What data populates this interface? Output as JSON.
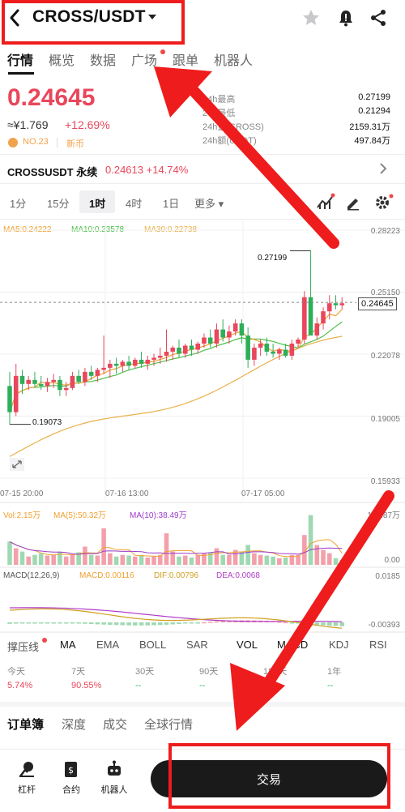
{
  "header": {
    "pair": "CROSS/USDT",
    "icons": [
      "back-icon",
      "chevron-down-icon",
      "star-icon",
      "alert-bell-icon",
      "share-icon"
    ]
  },
  "tabs": [
    {
      "label": "行情",
      "active": true
    },
    {
      "label": "概览"
    },
    {
      "label": "数据"
    },
    {
      "label": "广场",
      "dot": true
    },
    {
      "label": "跟单"
    },
    {
      "label": "机器人"
    }
  ],
  "quote": {
    "price": "0.24645",
    "cny": "≈¥1.769",
    "change_pct": "+12.69%",
    "rank": "NO.23",
    "tag": "新币"
  },
  "stats": [
    {
      "label": "24h最高",
      "value": "0.27199"
    },
    {
      "label": "24h最低",
      "value": "0.21294"
    },
    {
      "label": "24h量(CROSS)",
      "value": "2159.31万"
    },
    {
      "label": "24h额(USDT)",
      "value": "497.84万"
    }
  ],
  "perpetual": {
    "label": "CROSSUSDT 永续",
    "value": "0.24613 +14.74%"
  },
  "intervals": [
    {
      "label": "1分"
    },
    {
      "label": "15分"
    },
    {
      "label": "1时",
      "active": true
    },
    {
      "label": "4时"
    },
    {
      "label": "1日"
    },
    {
      "label": "更多 ▾"
    }
  ],
  "chart_data": {
    "type": "candlestick",
    "ma_legend": {
      "ma5": "MA5:0.24222",
      "ma10": "MA10:0.23578",
      "ma30": "MA30:0.22738"
    },
    "y_ticks": [
      "0.28223",
      "0.25150",
      "0.22078",
      "0.19005",
      "0.15933"
    ],
    "x_ticks": [
      "07-15 20:00",
      "07-16 13:00",
      "07-17 05:00"
    ],
    "high_label": "0.27199",
    "low_label": "0.19073",
    "last_price": "0.24645",
    "ylim": [
      0.15933,
      0.28223
    ],
    "candles": [
      [
        0.205,
        0.212,
        0.186,
        0.192
      ],
      [
        0.192,
        0.216,
        0.19,
        0.21
      ],
      [
        0.21,
        0.213,
        0.201,
        0.206
      ],
      [
        0.206,
        0.21,
        0.203,
        0.208
      ],
      [
        0.208,
        0.212,
        0.204,
        0.206
      ],
      [
        0.206,
        0.21,
        0.203,
        0.205
      ],
      [
        0.205,
        0.209,
        0.202,
        0.207
      ],
      [
        0.207,
        0.211,
        0.204,
        0.208
      ],
      [
        0.208,
        0.21,
        0.2,
        0.203
      ],
      [
        0.203,
        0.207,
        0.2,
        0.204
      ],
      [
        0.204,
        0.212,
        0.203,
        0.21
      ],
      [
        0.21,
        0.213,
        0.206,
        0.207
      ],
      [
        0.207,
        0.214,
        0.205,
        0.212
      ],
      [
        0.212,
        0.215,
        0.208,
        0.21
      ],
      [
        0.21,
        0.214,
        0.207,
        0.213
      ],
      [
        0.213,
        0.23,
        0.211,
        0.214
      ],
      [
        0.214,
        0.218,
        0.209,
        0.216
      ],
      [
        0.216,
        0.219,
        0.211,
        0.215
      ],
      [
        0.215,
        0.218,
        0.212,
        0.217
      ],
      [
        0.217,
        0.22,
        0.213,
        0.215
      ],
      [
        0.215,
        0.219,
        0.214,
        0.218
      ],
      [
        0.218,
        0.222,
        0.214,
        0.216
      ],
      [
        0.216,
        0.22,
        0.213,
        0.218
      ],
      [
        0.218,
        0.221,
        0.215,
        0.219
      ],
      [
        0.219,
        0.224,
        0.216,
        0.22
      ],
      [
        0.22,
        0.233,
        0.217,
        0.222
      ],
      [
        0.222,
        0.225,
        0.218,
        0.224
      ],
      [
        0.224,
        0.228,
        0.219,
        0.221
      ],
      [
        0.221,
        0.226,
        0.219,
        0.225
      ],
      [
        0.225,
        0.228,
        0.22,
        0.223
      ],
      [
        0.223,
        0.227,
        0.221,
        0.226
      ],
      [
        0.226,
        0.231,
        0.224,
        0.229
      ],
      [
        0.229,
        0.233,
        0.224,
        0.226
      ],
      [
        0.226,
        0.236,
        0.224,
        0.233
      ],
      [
        0.233,
        0.238,
        0.227,
        0.229
      ],
      [
        0.229,
        0.235,
        0.226,
        0.232
      ],
      [
        0.232,
        0.238,
        0.23,
        0.236
      ],
      [
        0.236,
        0.238,
        0.226,
        0.23
      ],
      [
        0.23,
        0.234,
        0.214,
        0.218
      ],
      [
        0.218,
        0.226,
        0.215,
        0.224
      ],
      [
        0.224,
        0.228,
        0.22,
        0.226
      ],
      [
        0.226,
        0.229,
        0.22,
        0.222
      ],
      [
        0.222,
        0.226,
        0.219,
        0.221
      ],
      [
        0.221,
        0.224,
        0.218,
        0.223
      ],
      [
        0.223,
        0.226,
        0.219,
        0.22
      ],
      [
        0.22,
        0.228,
        0.218,
        0.226
      ],
      [
        0.226,
        0.229,
        0.224,
        0.228
      ],
      [
        0.228,
        0.252,
        0.226,
        0.249
      ],
      [
        0.249,
        0.272,
        0.23,
        0.23
      ],
      [
        0.23,
        0.239,
        0.228,
        0.236
      ],
      [
        0.236,
        0.244,
        0.233,
        0.242
      ],
      [
        0.242,
        0.25,
        0.238,
        0.246
      ],
      [
        0.246,
        0.25,
        0.243,
        0.245
      ],
      [
        0.245,
        0.249,
        0.243,
        0.246
      ]
    ],
    "volume": {
      "legend": {
        "vol": "Vol:2.15万",
        "ma5": "MA(5):50.32万",
        "ma10": "MA(10):38.49万"
      },
      "y_ticks": [
        "158.87万",
        "0.00"
      ],
      "max": 158.87,
      "values": [
        70,
        50,
        40,
        25,
        30,
        35,
        28,
        30,
        40,
        25,
        30,
        38,
        55,
        30,
        28,
        110,
        35,
        25,
        30,
        28,
        25,
        30,
        22,
        25,
        30,
        95,
        40,
        25,
        28,
        22,
        30,
        35,
        38,
        50,
        30,
        30,
        45,
        40,
        60,
        35,
        30,
        28,
        25,
        20,
        22,
        30,
        30,
        90,
        150,
        60,
        45,
        35,
        20,
        15
      ]
    },
    "macd": {
      "legend": {
        "label": "MACD(12,26,9)",
        "macd": "MACD:0.00116",
        "dif": "DIF:0.00796",
        "dea": "DEA:0.0068"
      },
      "y_ticks": [
        "0.0185",
        "-0.00393"
      ]
    }
  },
  "indicators": [
    "撑压线",
    "MA",
    "EMA",
    "BOLL",
    "SAR",
    "VOL",
    "MACD",
    "KDJ",
    "RSI"
  ],
  "performance": [
    {
      "label": "今天",
      "value": "5.74%"
    },
    {
      "label": "7天",
      "value": "90.55%"
    },
    {
      "label": "30天",
      "value": "--"
    },
    {
      "label": "90天",
      "value": "--"
    },
    {
      "label": "180天",
      "value": "--"
    },
    {
      "label": "1年",
      "value": "--"
    }
  ],
  "bottom_tabs": [
    {
      "label": "订单簿",
      "active": true
    },
    {
      "label": "深度"
    },
    {
      "label": "成交"
    },
    {
      "label": "全球行情"
    }
  ],
  "footer": {
    "items": [
      {
        "label": "杠杆",
        "icon": "leverage-icon"
      },
      {
        "label": "合约",
        "icon": "contract-icon"
      },
      {
        "label": "机器人",
        "icon": "robot-icon"
      }
    ],
    "trade_label": "交易"
  },
  "colors": {
    "up": "#e8475c",
    "down": "#2daf5a",
    "ma5": "#f0a030",
    "ma10": "#4cc04a",
    "ma30": "#e8b04a",
    "annotation": "#ee1c1c"
  }
}
